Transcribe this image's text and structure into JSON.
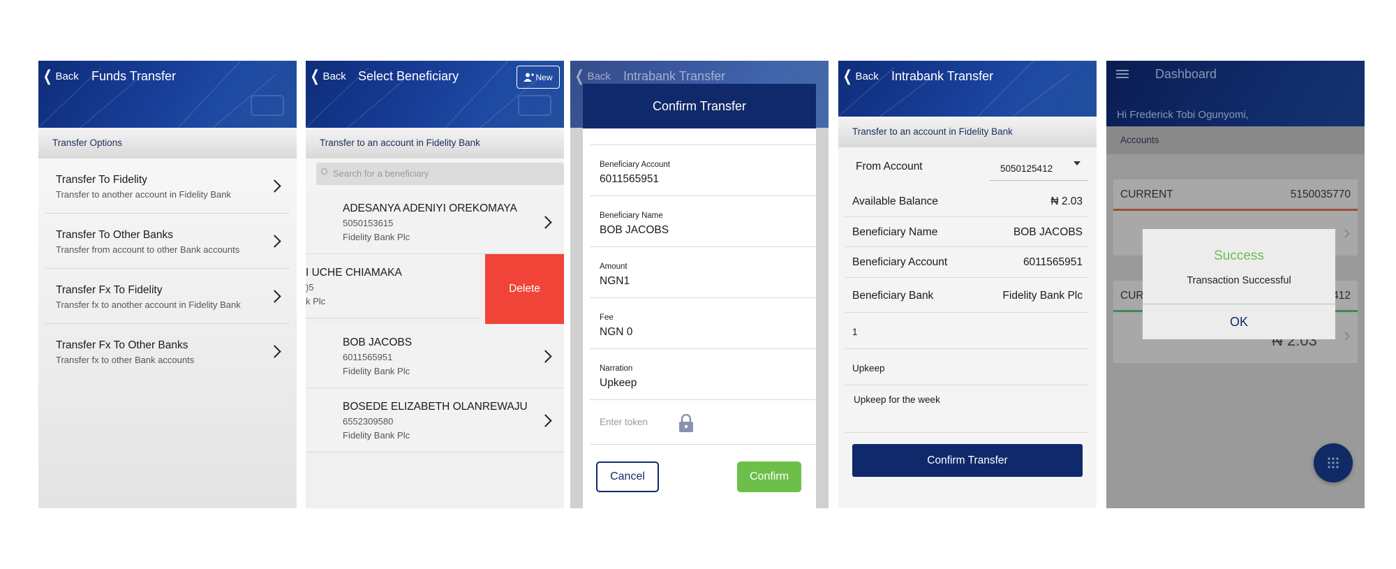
{
  "screen1": {
    "back_label": "Back",
    "title": "Funds Transfer",
    "subheader": "Transfer Options",
    "options": [
      {
        "title": "Transfer To Fidelity",
        "subtitle": "Transfer to another account in Fidelity Bank"
      },
      {
        "title": "Transfer To Other Banks",
        "subtitle": "Transfer from account to other Bank accounts"
      },
      {
        "title": "Transfer Fx To Fidelity",
        "subtitle": "Transfer fx to another account in Fidelity Bank"
      },
      {
        "title": "Transfer Fx To Other Banks",
        "subtitle": "Transfer fx to other Bank accounts"
      }
    ]
  },
  "screen2": {
    "back_label": "Back",
    "title": "Select Beneficiary",
    "new_label": "New",
    "subheader": "Transfer to an account in Fidelity Bank",
    "search_placeholder": "Search for a beneficiary",
    "beneficiaries": [
      {
        "name": "ADESANYA ADENIYI OREKOMAYA",
        "account": "5050153615",
        "bank": "Fidelity Bank Plc"
      },
      {
        "name": "I UCHE CHIAMAKA",
        "account": ")5",
        "bank": "k Plc"
      },
      {
        "name": "BOB JACOBS",
        "account": "6011565951",
        "bank": "Fidelity Bank Plc"
      },
      {
        "name": "BOSEDE ELIZABETH OLANREWAJU",
        "account": "6552309580",
        "bank": "Fidelity Bank Plc"
      }
    ],
    "delete_label": "Delete"
  },
  "screen3": {
    "back_label": "Back",
    "title": "Intrabank Transfer",
    "modal": {
      "title": "Confirm Transfer",
      "fields": [
        {
          "label": "Beneficiary Account",
          "value": "6011565951"
        },
        {
          "label": "Beneficiary Name",
          "value": "BOB JACOBS"
        },
        {
          "label": "Amount",
          "value": "NGN1"
        },
        {
          "label": "Fee",
          "value": "NGN 0"
        },
        {
          "label": "Narration",
          "value": "Upkeep"
        }
      ],
      "token_placeholder": "Enter token",
      "cancel_label": "Cancel",
      "confirm_label": "Confirm"
    }
  },
  "screen4": {
    "back_label": "Back",
    "title": "Intrabank Transfer",
    "subheader": "Transfer to an account in Fidelity Bank",
    "from_account_label": "From Account",
    "from_account_value": "5050125412",
    "rows": [
      {
        "label": "Available Balance",
        "value": "₦ 2.03"
      },
      {
        "label": "Beneficiary Name",
        "value": "BOB JACOBS"
      },
      {
        "label": "Beneficiary Account",
        "value": "6011565951"
      },
      {
        "label": "Beneficiary Bank",
        "value": "Fidelity Bank Plc"
      }
    ],
    "amount_value": "1",
    "narration_value": "Upkeep",
    "description_value": "Upkeep for the week",
    "confirm_label": "Confirm Transfer"
  },
  "screen5": {
    "title": "Dashboard",
    "greeting": "Hi Frederick Tobi Ogunyomi,",
    "accounts_label": "Accounts",
    "card1_type": "CURRENT",
    "card1_number": "5150035770",
    "card2_type": "CUR",
    "card2_number_partial": "412",
    "card2_balance": "₦ 2.03",
    "dialog": {
      "title": "Success",
      "message": "Transaction Successful",
      "ok_label": "OK"
    }
  },
  "colors": {
    "header_blue": "#173d97",
    "navy_button": "#10296a",
    "success_green": "#6cc04a",
    "delete_red": "#f04438"
  }
}
